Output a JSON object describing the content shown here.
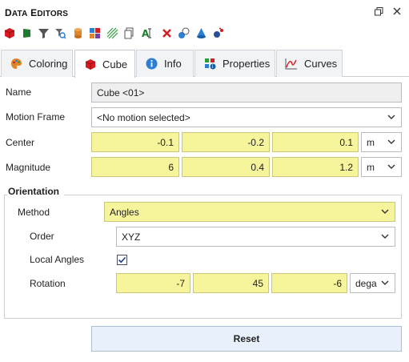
{
  "header": {
    "title_first_big": "D",
    "title_first_rest": "ATA",
    "title_second_big": "E",
    "title_second_rest": "DITORS",
    "restore_icon": "restore-window-icon",
    "close_icon": "close-icon"
  },
  "toolbar": {
    "icons": [
      "red-cube-icon",
      "green-flag-icon",
      "funnel-icon",
      "search-filter-icon",
      "cylinder-icon",
      "colored-cubes-icon",
      "wave-lines-icon",
      "copy-icon",
      "text-a-icon",
      "delete-x-icon",
      "spheres-icon",
      "cone-icon",
      "molecule-icon"
    ]
  },
  "tabs": [
    {
      "label": "Coloring",
      "icon": "palette-icon",
      "active": false
    },
    {
      "label": "Cube",
      "icon": "cube-icon",
      "active": true
    },
    {
      "label": "Info",
      "icon": "info-icon",
      "active": false
    },
    {
      "label": "Properties",
      "icon": "properties-icon",
      "active": false
    },
    {
      "label": "Curves",
      "icon": "curves-icon",
      "active": false
    }
  ],
  "form": {
    "name_label": "Name",
    "name_value": "Cube <01>",
    "motion_frame_label": "Motion Frame",
    "motion_frame_value": "<No motion selected>",
    "center_label": "Center",
    "center_values": [
      "-0.1",
      "-0.2",
      "0.1"
    ],
    "center_unit": "m",
    "magnitude_label": "Magnitude",
    "magnitude_values": [
      "6",
      "0.4",
      "1.2"
    ],
    "magnitude_unit": "m"
  },
  "orientation": {
    "title": "Orientation",
    "method_label": "Method",
    "method_value": "Angles",
    "order_label": "Order",
    "order_value": "XYZ",
    "local_angles_label": "Local Angles",
    "local_angles_checked": true,
    "rotation_label": "Rotation",
    "rotation_values": [
      "-7",
      "45",
      "-6"
    ],
    "rotation_unit": "dega"
  },
  "reset_label": "Reset",
  "colors": {
    "highlight": "#f7f59c",
    "accent_red": "#d81b22",
    "accent_blue": "#2a7fd4"
  }
}
